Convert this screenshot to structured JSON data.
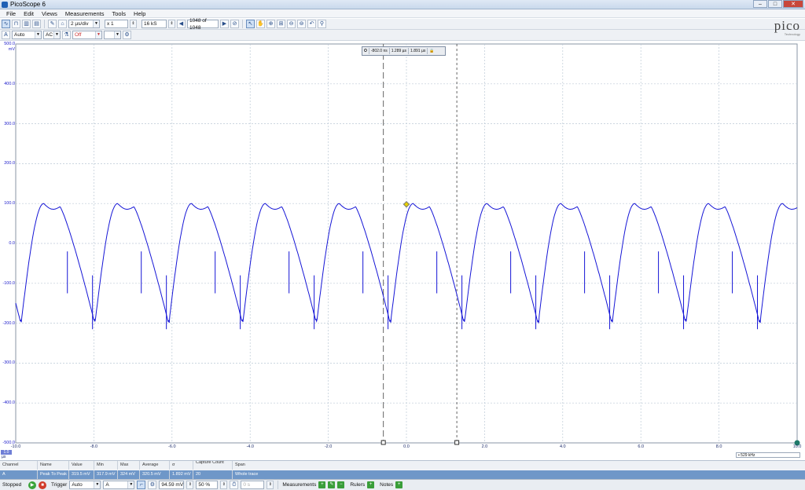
{
  "window": {
    "title": "PicoScope 6",
    "minimize": "–",
    "maximize": "□",
    "close": "✕"
  },
  "menu": [
    "File",
    "Edit",
    "Views",
    "Measurements",
    "Tools",
    "Help"
  ],
  "toolbar1": {
    "timebase": "2 µs/div",
    "zoom": "x 1",
    "samples": "16 kS",
    "buffer": "1048 of 1048"
  },
  "toolbar2": {
    "channel_label": "A",
    "range": "Auto",
    "coupling": "AC",
    "filter": "Off",
    "blank": ""
  },
  "logo": {
    "name": "pico",
    "tagline": "Technology"
  },
  "rulers": {
    "marker": "O",
    "delta_t": "-802.0 ns",
    "t1": "1.289 µs",
    "t2": "1.891 µs"
  },
  "y_axis": {
    "unit": "mV",
    "ticks": [
      "500.0",
      "400.0",
      "300.0",
      "200.0",
      "100.0",
      "0.0",
      "-100.0",
      "-200.0",
      "-300.0",
      "-400.0",
      "-500.0"
    ],
    "color": "#2222cc"
  },
  "x_axis": {
    "unit": "µs",
    "ticks": [
      "-10.0",
      "-8.0",
      "-6.0",
      "-4.0",
      "-2.0",
      "0.0",
      "2.0",
      "4.0",
      "6.0",
      "8.0",
      "10.0"
    ],
    "channel_tag": "1.0"
  },
  "freq_readout": "529 kHz",
  "measurements": {
    "headers": [
      "Channel",
      "Name",
      "Value",
      "Min",
      "Max",
      "Average",
      "σ",
      "Capture Count",
      "Span"
    ],
    "rows": [
      {
        "channel": "A",
        "name": "Peak To Peak",
        "value": "319.5 mV",
        "min": "317.9 mV",
        "max": "324 mV",
        "average": "320.5 mV",
        "sigma": "1.892 mV",
        "count": "20",
        "span": "Whole trace"
      }
    ]
  },
  "status": {
    "state": "Stopped",
    "trigger_label": "Trigger",
    "trigger_mode": "Auto",
    "trigger_channel": "A",
    "level": "94.59 mV",
    "pretrigger": "50 %",
    "delay": "0 s",
    "measurements_label": "Measurements",
    "rulers_label": "Rulers",
    "notes_label": "Notes"
  },
  "colors": {
    "trace": "#1515d6",
    "grid": "#bcc9d6",
    "accent": "#6f97c8"
  }
}
